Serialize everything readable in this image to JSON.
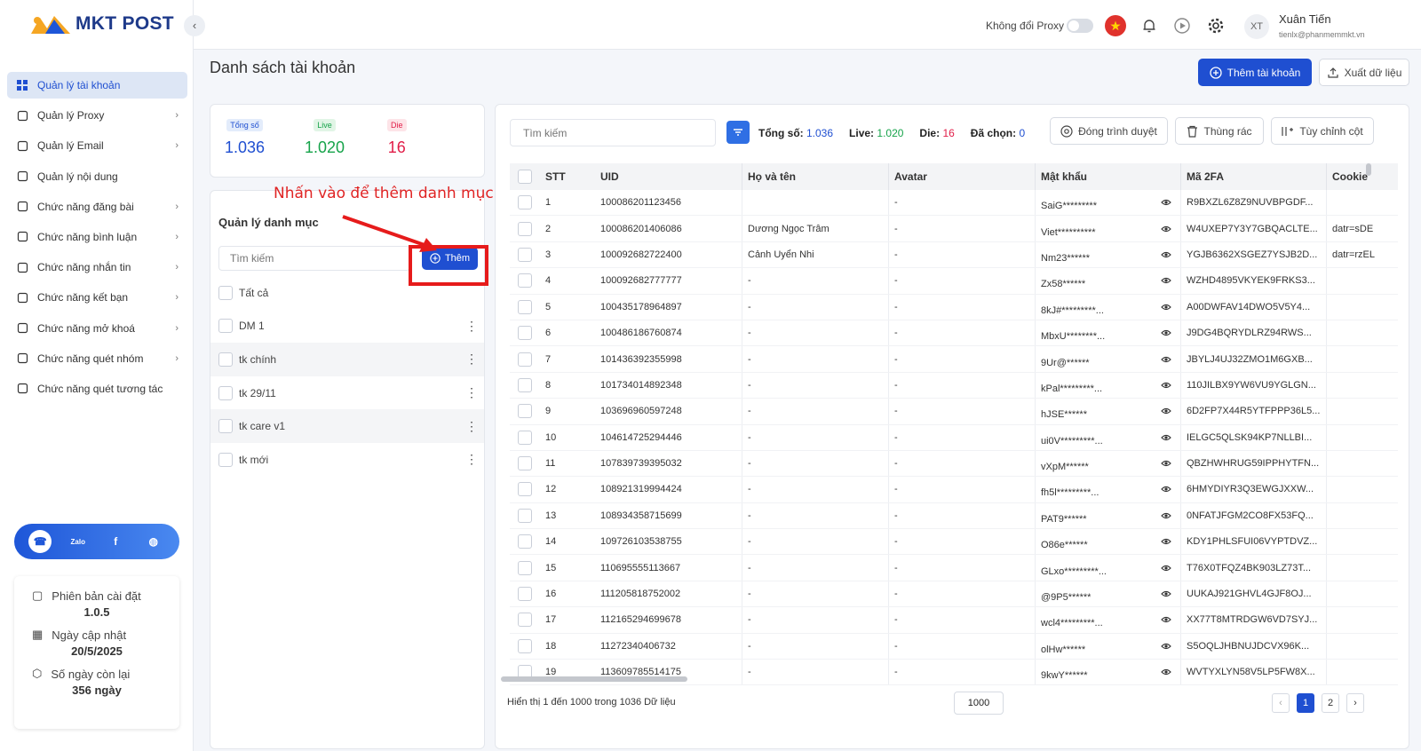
{
  "app": {
    "logo_text": "MKT POST",
    "collapse_glyph": "‹"
  },
  "sidebar": {
    "items": [
      {
        "label": "Quản lý tài khoản",
        "icon": "grid-icon",
        "active": true,
        "chevron": false
      },
      {
        "label": "Quản lý Proxy",
        "icon": "layers-icon",
        "active": false,
        "chevron": true
      },
      {
        "label": "Quản lý Email",
        "icon": "mail-icon",
        "active": false,
        "chevron": true
      },
      {
        "label": "Quản lý nội dung",
        "icon": "shuffle-icon",
        "active": false,
        "chevron": false
      },
      {
        "label": "Chức năng đăng bài",
        "icon": "post-icon",
        "active": false,
        "chevron": true
      },
      {
        "label": "Chức năng bình luận",
        "icon": "comment-icon",
        "active": false,
        "chevron": true
      },
      {
        "label": "Chức năng nhắn tin",
        "icon": "chat-icon",
        "active": false,
        "chevron": true
      },
      {
        "label": "Chức năng kết bạn",
        "icon": "add-friend-icon",
        "active": false,
        "chevron": true
      },
      {
        "label": "Chức năng mở khoá",
        "icon": "lock-icon",
        "active": false,
        "chevron": true
      },
      {
        "label": "Chức năng quét nhóm",
        "icon": "group-icon",
        "active": false,
        "chevron": true
      },
      {
        "label": "Chức năng quét tương tác",
        "icon": "scan-icon",
        "active": false,
        "chevron": false
      }
    ],
    "chevron_glyph": "›",
    "social": [
      {
        "name": "support-icon",
        "glyph": "☎"
      },
      {
        "name": "zalo-icon",
        "glyph": "Zalo"
      },
      {
        "name": "facebook-icon",
        "glyph": "f"
      },
      {
        "name": "web-icon",
        "glyph": "◍"
      }
    ],
    "version": {
      "install_label": "Phiên bản cài đặt",
      "install_value": "1.0.5",
      "update_label": "Ngày cập nhật",
      "update_value": "20/5/2025",
      "remaining_label": "Số ngày còn lại",
      "remaining_value": "356 ngày"
    }
  },
  "topbar": {
    "proxy_label": "Không đổi Proxy",
    "avatar_initials": "XT",
    "user_name": "Xuân Tiến",
    "user_email": "tienlx@phanmemmkt.vn"
  },
  "page": {
    "title": "Danh sách tài khoản",
    "add_account": "Thêm tài khoản",
    "export": "Xuất dữ liệu"
  },
  "stats": {
    "total_label": "Tổng số",
    "total_value": "1.036",
    "live_label": "Live",
    "live_value": "1.020",
    "die_label": "Die",
    "die_value": "16"
  },
  "categories": {
    "annotation": "Nhấn vào để thêm danh mục",
    "title": "Quản lý danh mục",
    "search_placeholder": "Tìm kiếm",
    "add_label": "Thêm",
    "all_label": "Tất cả",
    "items": [
      "DM 1",
      "tk chính",
      "tk 29/11",
      "tk care v1",
      "tk mới"
    ],
    "kebab_glyph": "⋮"
  },
  "table": {
    "search_placeholder": "Tìm kiếm",
    "total_label": "Tổng số:",
    "total_value": "1.036",
    "live_label": "Live:",
    "live_value": "1.020",
    "die_label": "Die:",
    "die_value": "16",
    "selected_label": "Đã chọn:",
    "selected_value": "0",
    "close_browser": "Đóng trình duyệt",
    "trash": "Thùng rác",
    "customize_columns": "Tùy chỉnh cột",
    "columns": {
      "stt": "STT",
      "uid": "UID",
      "name": "Họ và tên",
      "avatar": "Avatar",
      "password": "Mật khẩu",
      "twofa": "Mã 2FA",
      "cookie": "Cookie"
    },
    "rows": [
      {
        "stt": "1",
        "uid": "100086201123456",
        "name": "",
        "avatar": "-",
        "password": "SaiG*********",
        "twofa": "R9BXZL6Z8Z9NUVBPGDF...",
        "cookie": ""
      },
      {
        "stt": "2",
        "uid": "100086201406086",
        "name": "Dương Ngọc Trâm",
        "avatar": "-",
        "password": "Viet**********",
        "twofa": "W4UXEP7Y3Y7GBQACLTE...",
        "cookie": "datr=sDE"
      },
      {
        "stt": "3",
        "uid": "100092682722400",
        "name": "Cảnh Uyển Nhi",
        "avatar": "-",
        "password": "Nm23******",
        "twofa": "YGJB6362XSGEZ7YSJB2D...",
        "cookie": "datr=rzEL"
      },
      {
        "stt": "4",
        "uid": "100092682777777",
        "name": "-",
        "avatar": "-",
        "password": "Zx58******",
        "twofa": "WZHD4895VKYEK9FRKS3...",
        "cookie": ""
      },
      {
        "stt": "5",
        "uid": "100435178964897",
        "name": "-",
        "avatar": "-",
        "password": "8kJ#*********...",
        "twofa": "A00DWFAV14DWO5V5Y4...",
        "cookie": ""
      },
      {
        "stt": "6",
        "uid": "100486186760874",
        "name": "-",
        "avatar": "-",
        "password": "MbxU********...",
        "twofa": "J9DG4BQRYDLRZ94RWS...",
        "cookie": ""
      },
      {
        "stt": "7",
        "uid": "101436392355998",
        "name": "-",
        "avatar": "-",
        "password": "9Ur@******",
        "twofa": "JBYLJ4UJ32ZMO1M6GXB...",
        "cookie": ""
      },
      {
        "stt": "8",
        "uid": "101734014892348",
        "name": "-",
        "avatar": "-",
        "password": "kPal*********...",
        "twofa": "110JILBX9YW6VU9YGLGN...",
        "cookie": ""
      },
      {
        "stt": "9",
        "uid": "103696960597248",
        "name": "-",
        "avatar": "-",
        "password": "hJSE******",
        "twofa": "6D2FP7X44R5YTFPPP36L5...",
        "cookie": ""
      },
      {
        "stt": "10",
        "uid": "104614725294446",
        "name": "-",
        "avatar": "-",
        "password": "ui0V*********...",
        "twofa": "IELGC5QLSK94KP7NLLBI...",
        "cookie": ""
      },
      {
        "stt": "11",
        "uid": "107839739395032",
        "name": "-",
        "avatar": "-",
        "password": "vXpM******",
        "twofa": "QBZHWHRUG59IPPHYTFN...",
        "cookie": ""
      },
      {
        "stt": "12",
        "uid": "108921319994424",
        "name": "-",
        "avatar": "-",
        "password": "fh5l*********...",
        "twofa": "6HMYDIYR3Q3EWGJXXW...",
        "cookie": ""
      },
      {
        "stt": "13",
        "uid": "108934358715699",
        "name": "-",
        "avatar": "-",
        "password": "PAT9******",
        "twofa": "0NFATJFGM2CO8FX53FQ...",
        "cookie": ""
      },
      {
        "stt": "14",
        "uid": "109726103538755",
        "name": "-",
        "avatar": "-",
        "password": "O86e******",
        "twofa": "KDY1PHLSFUI06VYPTDVZ...",
        "cookie": ""
      },
      {
        "stt": "15",
        "uid": "110695555113667",
        "name": "-",
        "avatar": "-",
        "password": "GLxo*********...",
        "twofa": "T76X0TFQZ4BK903LZ73T...",
        "cookie": ""
      },
      {
        "stt": "16",
        "uid": "111205818752002",
        "name": "-",
        "avatar": "-",
        "password": "@9P5******",
        "twofa": "UUKAJ921GHVL4GJF8OJ...",
        "cookie": ""
      },
      {
        "stt": "17",
        "uid": "112165294699678",
        "name": "-",
        "avatar": "-",
        "password": "wcl4*********...",
        "twofa": "XX77T8MTRDGW6VD7SYJ...",
        "cookie": ""
      },
      {
        "stt": "18",
        "uid": "11272340406732",
        "name": "-",
        "avatar": "-",
        "password": "olHw******",
        "twofa": "S5OQLJHBNUJDCVX96K...",
        "cookie": ""
      },
      {
        "stt": "19",
        "uid": "113609785514175",
        "name": "-",
        "avatar": "-",
        "password": "9kwY******",
        "twofa": "WVTYXLYN58V5LP5FW8X...",
        "cookie": ""
      }
    ],
    "footer_text": "Hiển thị 1 đến 1000 trong 1036 Dữ liệu",
    "page_size": "1000",
    "prev": "‹",
    "next": "›",
    "pages": [
      "1",
      "2"
    ],
    "current_page": "1"
  },
  "colors": {
    "primary": "#1f4fd1",
    "live": "#16a34a",
    "die": "#e11d48",
    "total": "#1f4fd1",
    "annotation": "#e61b1b"
  }
}
